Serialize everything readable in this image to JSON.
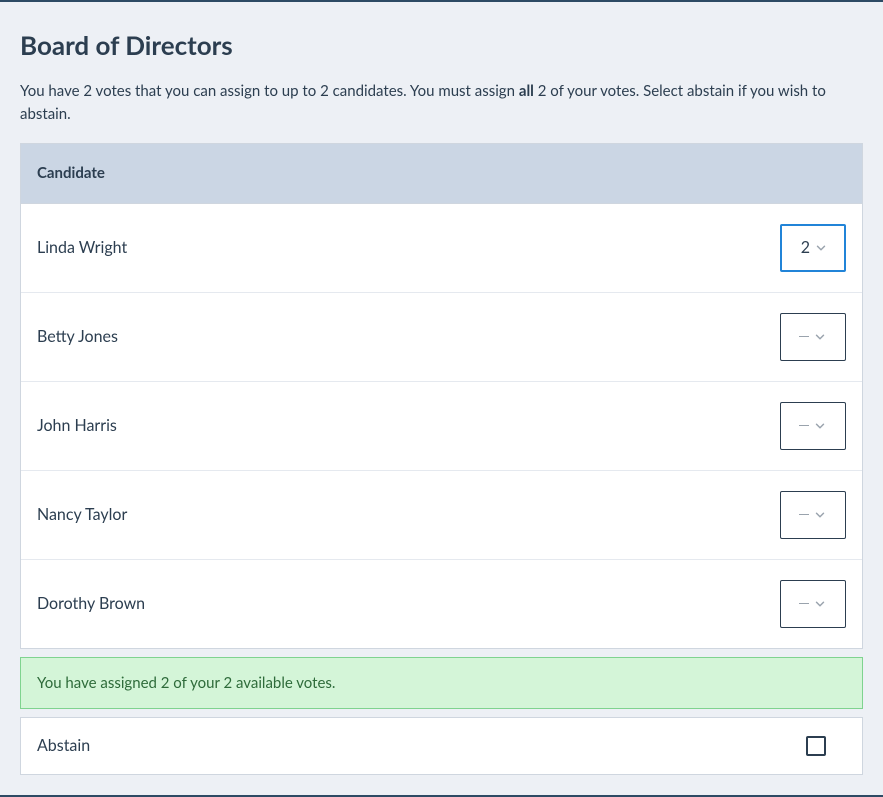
{
  "title": "Board of Directors",
  "instructions": {
    "pre": "You have 2 votes that you can assign to up to 2 candidates. You must assign ",
    "strong": "all",
    "post": " 2 of your votes. Select abstain if you wish to abstain."
  },
  "table_header": "Candidate",
  "candidates": [
    {
      "name": "Linda Wright",
      "value": "2",
      "selected": true
    },
    {
      "name": "Betty Jones",
      "value": "",
      "selected": false
    },
    {
      "name": "John Harris",
      "value": "",
      "selected": false
    },
    {
      "name": "Nancy Taylor",
      "value": "",
      "selected": false
    },
    {
      "name": "Dorothy Brown",
      "value": "",
      "selected": false
    }
  ],
  "status_message": "You have assigned 2 of your 2 available votes.",
  "abstain_label": "Abstain",
  "abstain_checked": false,
  "colors": {
    "accent": "#2184d8",
    "success_bg": "#d4f5d8",
    "success_border": "#7fd38f",
    "success_text": "#2e6b3a"
  }
}
